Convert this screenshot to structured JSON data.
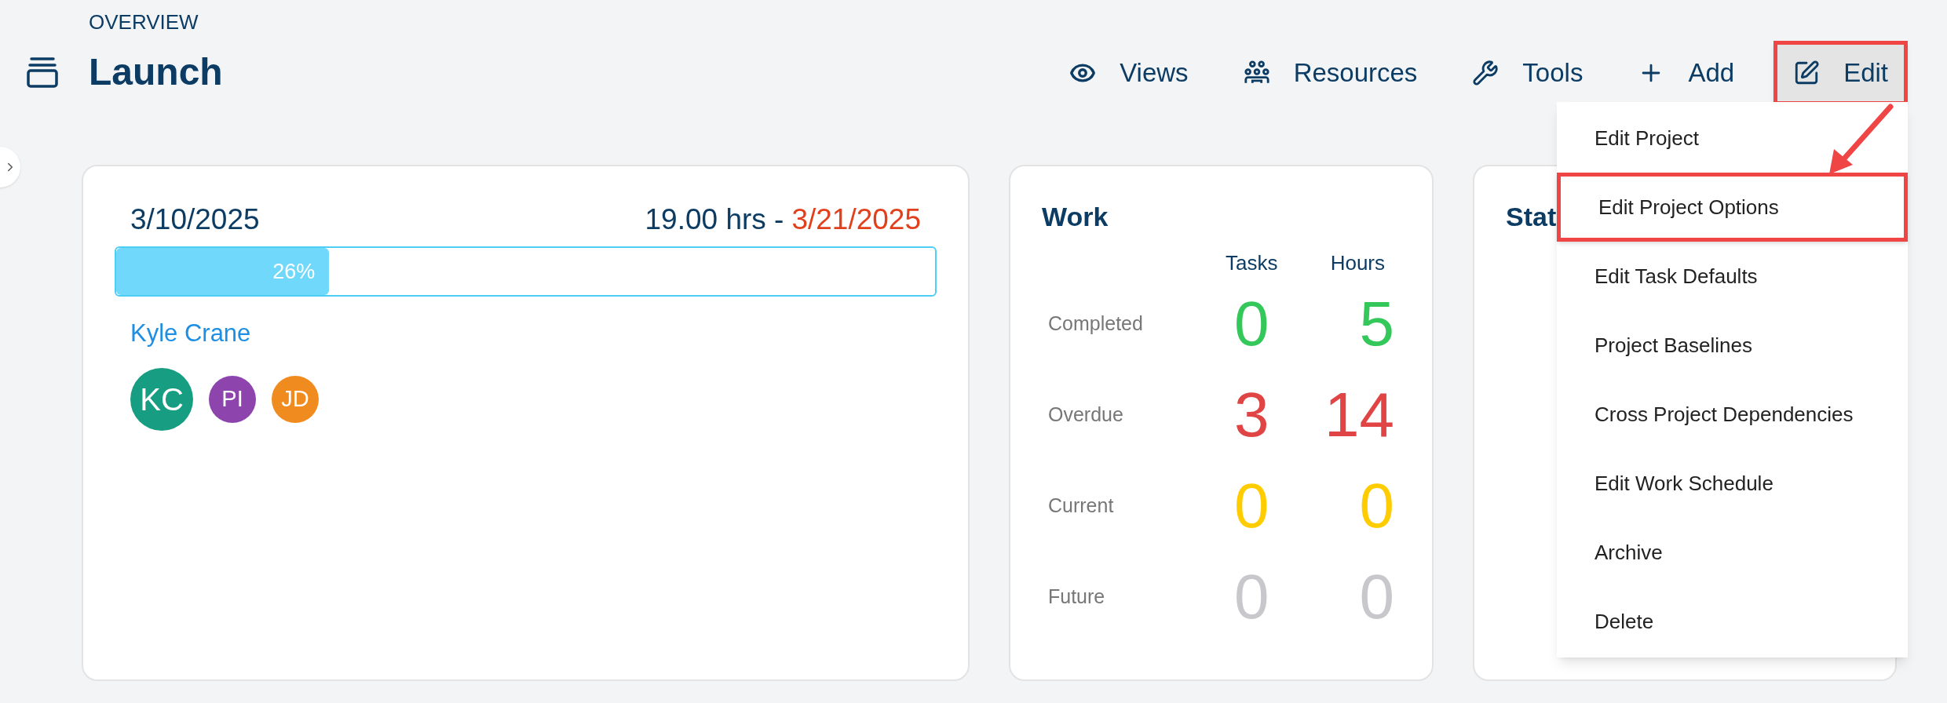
{
  "header": {
    "section": "OVERVIEW",
    "title": "Launch"
  },
  "toolbar": [
    {
      "kind": "views",
      "label": "Views",
      "highlighted": false
    },
    {
      "kind": "resources",
      "label": "Resources",
      "highlighted": false
    },
    {
      "kind": "tools",
      "label": "Tools",
      "highlighted": false
    },
    {
      "kind": "add",
      "label": "Add",
      "highlighted": false
    },
    {
      "kind": "edit",
      "label": "Edit",
      "highlighted": true
    }
  ],
  "project_card": {
    "start": "3/10/2025",
    "hours": "19.00 hrs -",
    "end": "3/21/2025",
    "progress": {
      "level": 0.26,
      "reading": "26%"
    },
    "owner": "Kyle Crane",
    "avatars": [
      {
        "initials": "KC",
        "color": "#179e82",
        "large": true
      },
      {
        "initials": "PI",
        "color": "#8e44ad",
        "large": false
      },
      {
        "initials": "JD",
        "color": "#f08c1f",
        "large": false
      }
    ]
  },
  "work_card": {
    "title": "Work",
    "columns": [
      "Tasks",
      "Hours"
    ],
    "rows": [
      {
        "label": "Completed",
        "tasks": "0",
        "hours": "5",
        "color": "#34c759"
      },
      {
        "label": "Overdue",
        "tasks": "3",
        "hours": "14",
        "color": "#e04444"
      },
      {
        "label": "Current",
        "tasks": "0",
        "hours": "0",
        "color": "#ffcc00"
      },
      {
        "label": "Future",
        "tasks": "0",
        "hours": "0",
        "color": "#c7c7cc"
      }
    ]
  },
  "status_card": {
    "title": "Stat"
  },
  "edit_menu": [
    {
      "label": "Edit Project",
      "highlighted": false
    },
    {
      "label": "Edit Project Options",
      "highlighted": true
    },
    {
      "label": "Edit Task Defaults",
      "highlighted": false
    },
    {
      "label": "Project Baselines",
      "highlighted": false
    },
    {
      "label": "Cross Project Dependencies",
      "highlighted": false
    },
    {
      "label": "Edit Work Schedule",
      "highlighted": false
    },
    {
      "label": "Archive",
      "highlighted": false
    },
    {
      "label": "Delete",
      "highlighted": false
    }
  ]
}
